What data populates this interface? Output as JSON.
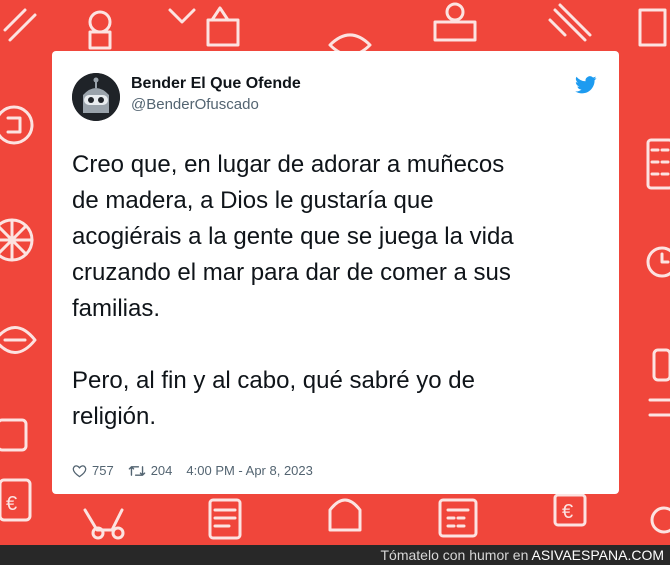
{
  "tweet": {
    "author_name": "Bender El Que Ofende",
    "handle": "@BenderOfuscado",
    "text": "Creo que, en lugar de adorar a muñecos\nde madera, a Dios le gustaría que\nacogiérais a la gente que se juega la vida\ncruzando el mar para dar de comer a sus\nfamilias.\n\nPero, al fin y al cabo, qué sabré yo de\nreligión.",
    "likes": "757",
    "retweets": "204",
    "timestamp": "4:00 PM - Apr 8, 2023"
  },
  "icons": {
    "platform": "twitter-bird-icon",
    "likes": "heart-icon",
    "retweets": "retweet-icon",
    "avatar": "bender-avatar"
  },
  "footer": {
    "prefix": "Tómatelo con humor en",
    "brand": "ASIVAESPANA.COM"
  },
  "colors": {
    "background": "#f0463b",
    "card": "#ffffff",
    "twitter_blue": "#1d9bf0",
    "text": "#0f1419",
    "muted": "#536471",
    "footer_bg": "#282828"
  }
}
